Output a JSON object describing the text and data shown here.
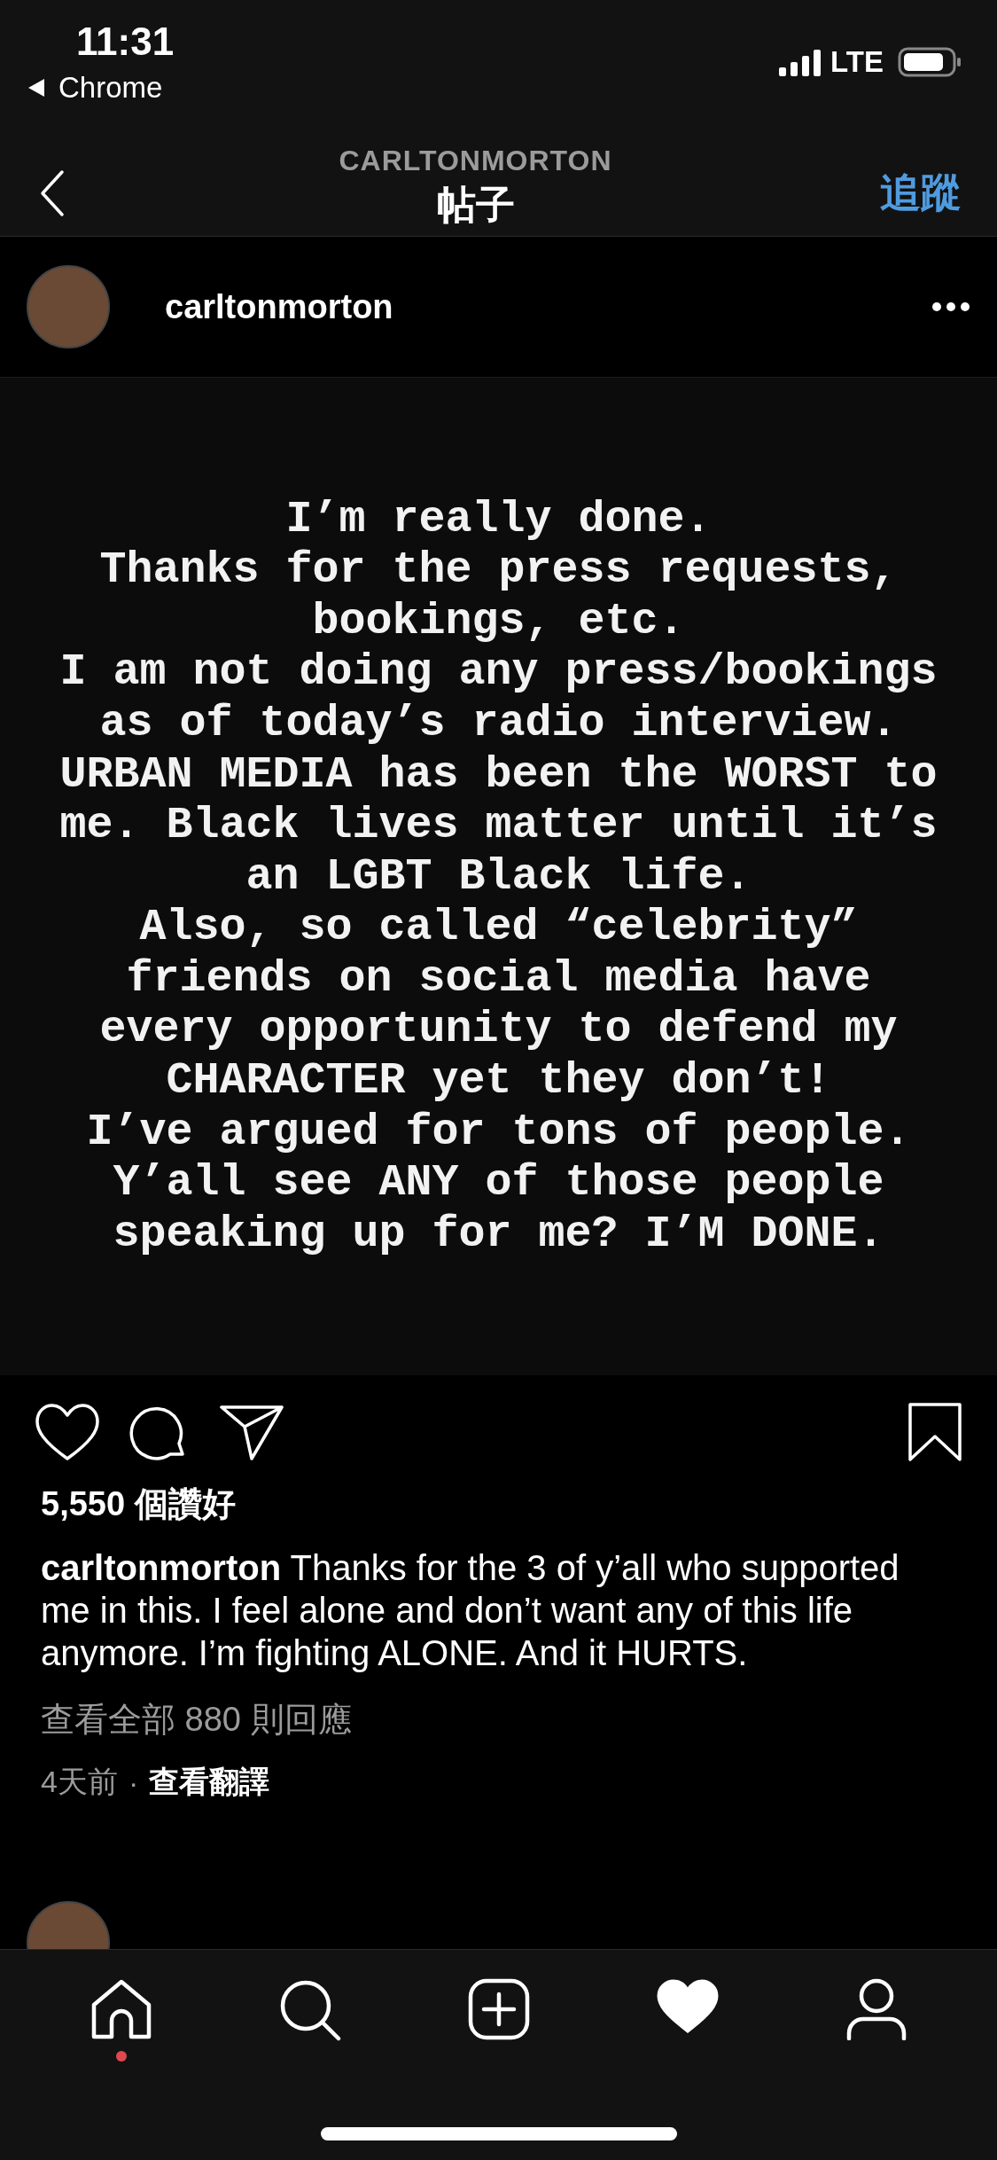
{
  "status_bar": {
    "time": "11:31",
    "back_app": "Chrome",
    "network": "LTE"
  },
  "nav": {
    "subtitle": "CARLTONMORTON",
    "title": "帖子",
    "action": "追蹤"
  },
  "post": {
    "username": "carltonmorton",
    "image_lines": [
      "I’m really done.",
      "Thanks for the press requests,",
      "bookings, etc.",
      "I am not doing any press/bookings",
      "as of today’s radio interview.",
      "URBAN MEDIA has been the WORST to",
      "me. Black lives matter until it’s",
      "an LGBT Black life.",
      "Also, so called “celebrity”",
      "friends on social media have",
      "every opportunity to defend my",
      "CHARACTER yet they don’t!",
      "I’ve argued for tons of people.",
      "Y’all see ANY of those people",
      "speaking up for me? I’M DONE."
    ],
    "likes": "5,550 個讚好",
    "caption": "**carltonmorton** Thanks for the 3 of y’all who supported me in this. I feel alone and don’t want any of this life anymore. I’m fighting ALONE. And it HURTS.",
    "view_comments": "查看全部 880 則回應",
    "time_ago": "4天前",
    "separator": "·",
    "translate": "查看翻譯"
  },
  "tab_bar": [
    {
      "kind": "home",
      "selected": false,
      "badge": true
    },
    {
      "kind": "search",
      "selected": false,
      "badge": false
    },
    {
      "kind": "add",
      "selected": false,
      "badge": false
    },
    {
      "kind": "activity",
      "selected": true,
      "badge": false
    },
    {
      "kind": "profile",
      "selected": false,
      "badge": false
    }
  ]
}
